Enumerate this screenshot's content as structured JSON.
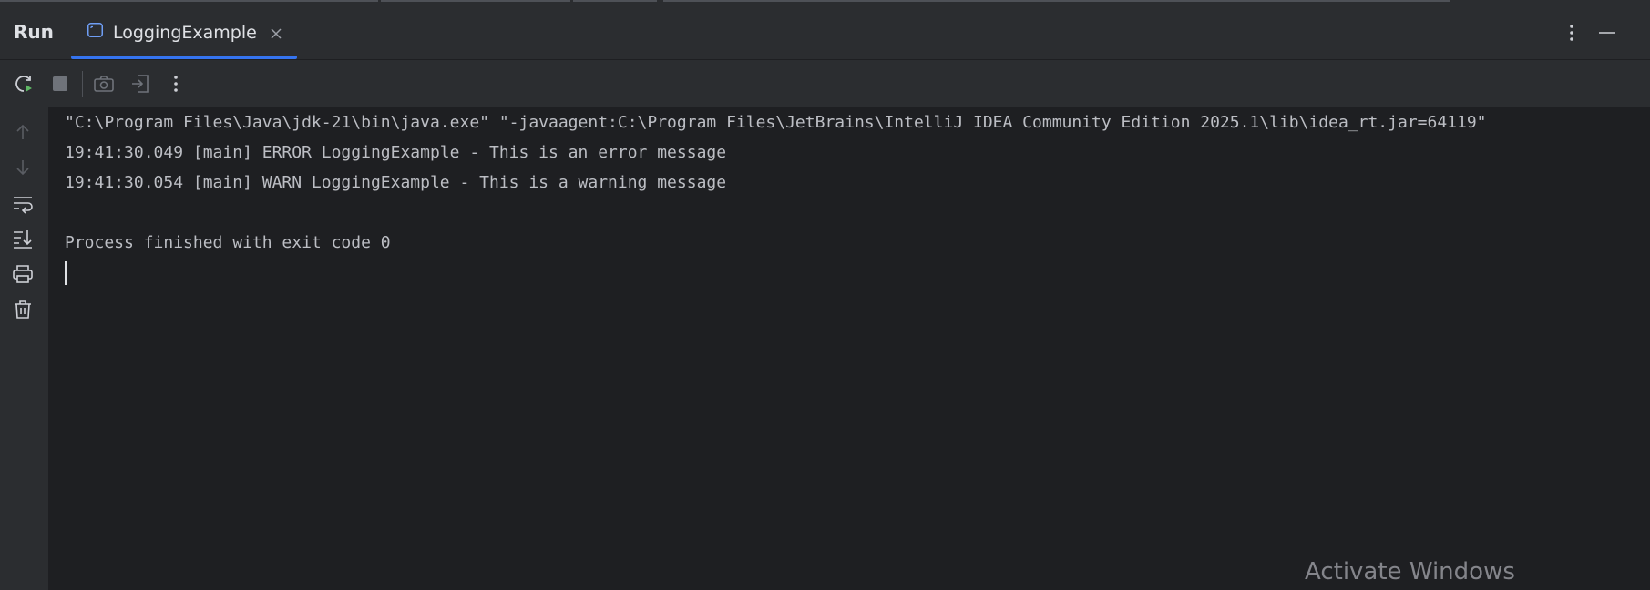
{
  "window": {
    "title": "Run"
  },
  "tabs": [
    {
      "label": "LoggingExample",
      "active": true
    }
  ],
  "header": {
    "options_icon": "vertical-dots-icon",
    "minimize_icon": "minimize-icon"
  },
  "toolbar": {
    "buttons": [
      {
        "name": "rerun",
        "icon": "rerun-icon",
        "enabled": true
      },
      {
        "name": "stop",
        "icon": "stop-icon",
        "enabled": false
      },
      {
        "name": "screenshot",
        "icon": "camera-icon",
        "enabled": false
      },
      {
        "name": "exit",
        "icon": "exit-icon",
        "enabled": false
      },
      {
        "name": "more",
        "icon": "vertical-dots-icon",
        "enabled": true
      }
    ]
  },
  "sidebar": {
    "buttons": [
      {
        "name": "up",
        "icon": "arrow-up-icon",
        "enabled": false
      },
      {
        "name": "down",
        "icon": "arrow-down-icon",
        "enabled": false
      },
      {
        "name": "soft-wrap",
        "icon": "soft-wrap-icon",
        "enabled": true
      },
      {
        "name": "scroll-to-end",
        "icon": "scroll-to-end-icon",
        "enabled": true
      },
      {
        "name": "print",
        "icon": "print-icon",
        "enabled": true
      },
      {
        "name": "clear",
        "icon": "trash-icon",
        "enabled": true
      }
    ]
  },
  "console": {
    "lines": [
      "\"C:\\Program Files\\Java\\jdk-21\\bin\\java.exe\" \"-javaagent:C:\\Program Files\\JetBrains\\IntelliJ IDEA Community Edition 2025.1\\lib\\idea_rt.jar=64119\"",
      "19:41:30.049 [main] ERROR LoggingExample - This is an error message",
      "19:41:30.054 [main] WARN LoggingExample - This is a warning message",
      "",
      "Process finished with exit code 0"
    ]
  },
  "watermark": {
    "text": "Activate Windows"
  },
  "colors": {
    "background": "#1e1f22",
    "panel": "#2b2d30",
    "accent": "#3574f0",
    "text": "#bcbec4",
    "run_green": "#5fb865"
  }
}
